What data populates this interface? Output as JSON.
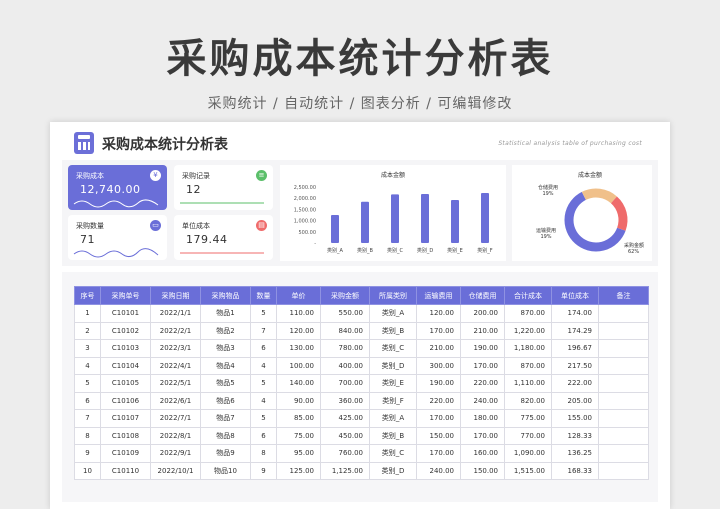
{
  "hero": {
    "title": "采购成本统计分析表",
    "subtitle": "采购统计 / 自动统计 / 图表分析 / 可编辑修改"
  },
  "sheet": {
    "title": "采购成本统计分析表",
    "subtitle_en": "Statistical analysis table of purchasing cost"
  },
  "kpis": {
    "cost": {
      "label": "采购成本",
      "value": "12,740.00"
    },
    "records": {
      "label": "采购记录",
      "value": "12"
    },
    "quantity": {
      "label": "采购数量",
      "value": "71"
    },
    "unit_cost": {
      "label": "单位成本",
      "value": "179.44"
    }
  },
  "colors": {
    "accent": "#6a6ed8",
    "ring_orange": "#f0c08a",
    "ring_red": "#ef6b6b",
    "ring_blue": "#6a6ed8",
    "green": "#5bbf6a"
  },
  "chart_data": [
    {
      "type": "bar",
      "title": "成本金额",
      "categories": [
        "类别_A",
        "类别_B",
        "类别_C",
        "类别_D",
        "类别_E",
        "类别_F"
      ],
      "values": [
        1250,
        1840,
        2170,
        2190,
        1920,
        2230
      ],
      "yticks": [
        "2,500.00",
        "2,000.00",
        "1,500.00",
        "1,000.00",
        "500.00",
        "-"
      ],
      "ylim": [
        0,
        2500
      ]
    },
    {
      "type": "pie",
      "title": "成本金额",
      "slices": [
        {
          "label": "采购金额",
          "percent": "62%",
          "value": 62
        },
        {
          "label": "运输费用",
          "percent": "19%",
          "value": 19
        },
        {
          "label": "仓储费用",
          "percent": "19%",
          "value": 19
        }
      ]
    }
  ],
  "table": {
    "headers": [
      "序号",
      "采购单号",
      "采购日期",
      "采购物品",
      "数量",
      "单价",
      "采购金额",
      "所属类别",
      "运输费用",
      "仓储费用",
      "合计成本",
      "单位成本",
      "备注"
    ],
    "rows": [
      [
        "1",
        "C10101",
        "2022/1/1",
        "物品1",
        "5",
        "110.00",
        "550.00",
        "类别_A",
        "120.00",
        "200.00",
        "870.00",
        "174.00",
        ""
      ],
      [
        "2",
        "C10102",
        "2022/2/1",
        "物品2",
        "7",
        "120.00",
        "840.00",
        "类别_B",
        "170.00",
        "210.00",
        "1,220.00",
        "174.29",
        ""
      ],
      [
        "3",
        "C10103",
        "2022/3/1",
        "物品3",
        "6",
        "130.00",
        "780.00",
        "类别_C",
        "210.00",
        "190.00",
        "1,180.00",
        "196.67",
        ""
      ],
      [
        "4",
        "C10104",
        "2022/4/1",
        "物品4",
        "4",
        "100.00",
        "400.00",
        "类别_D",
        "300.00",
        "170.00",
        "870.00",
        "217.50",
        ""
      ],
      [
        "5",
        "C10105",
        "2022/5/1",
        "物品5",
        "5",
        "140.00",
        "700.00",
        "类别_E",
        "190.00",
        "220.00",
        "1,110.00",
        "222.00",
        ""
      ],
      [
        "6",
        "C10106",
        "2022/6/1",
        "物品6",
        "4",
        "90.00",
        "360.00",
        "类别_F",
        "220.00",
        "240.00",
        "820.00",
        "205.00",
        ""
      ],
      [
        "7",
        "C10107",
        "2022/7/1",
        "物品7",
        "5",
        "85.00",
        "425.00",
        "类别_A",
        "170.00",
        "180.00",
        "775.00",
        "155.00",
        ""
      ],
      [
        "8",
        "C10108",
        "2022/8/1",
        "物品8",
        "6",
        "75.00",
        "450.00",
        "类别_B",
        "150.00",
        "170.00",
        "770.00",
        "128.33",
        ""
      ],
      [
        "9",
        "C10109",
        "2022/9/1",
        "物品9",
        "8",
        "95.00",
        "760.00",
        "类别_C",
        "170.00",
        "160.00",
        "1,090.00",
        "136.25",
        ""
      ],
      [
        "10",
        "C10110",
        "2022/10/1",
        "物品10",
        "9",
        "125.00",
        "1,125.00",
        "类别_D",
        "240.00",
        "150.00",
        "1,515.00",
        "168.33",
        ""
      ]
    ]
  }
}
